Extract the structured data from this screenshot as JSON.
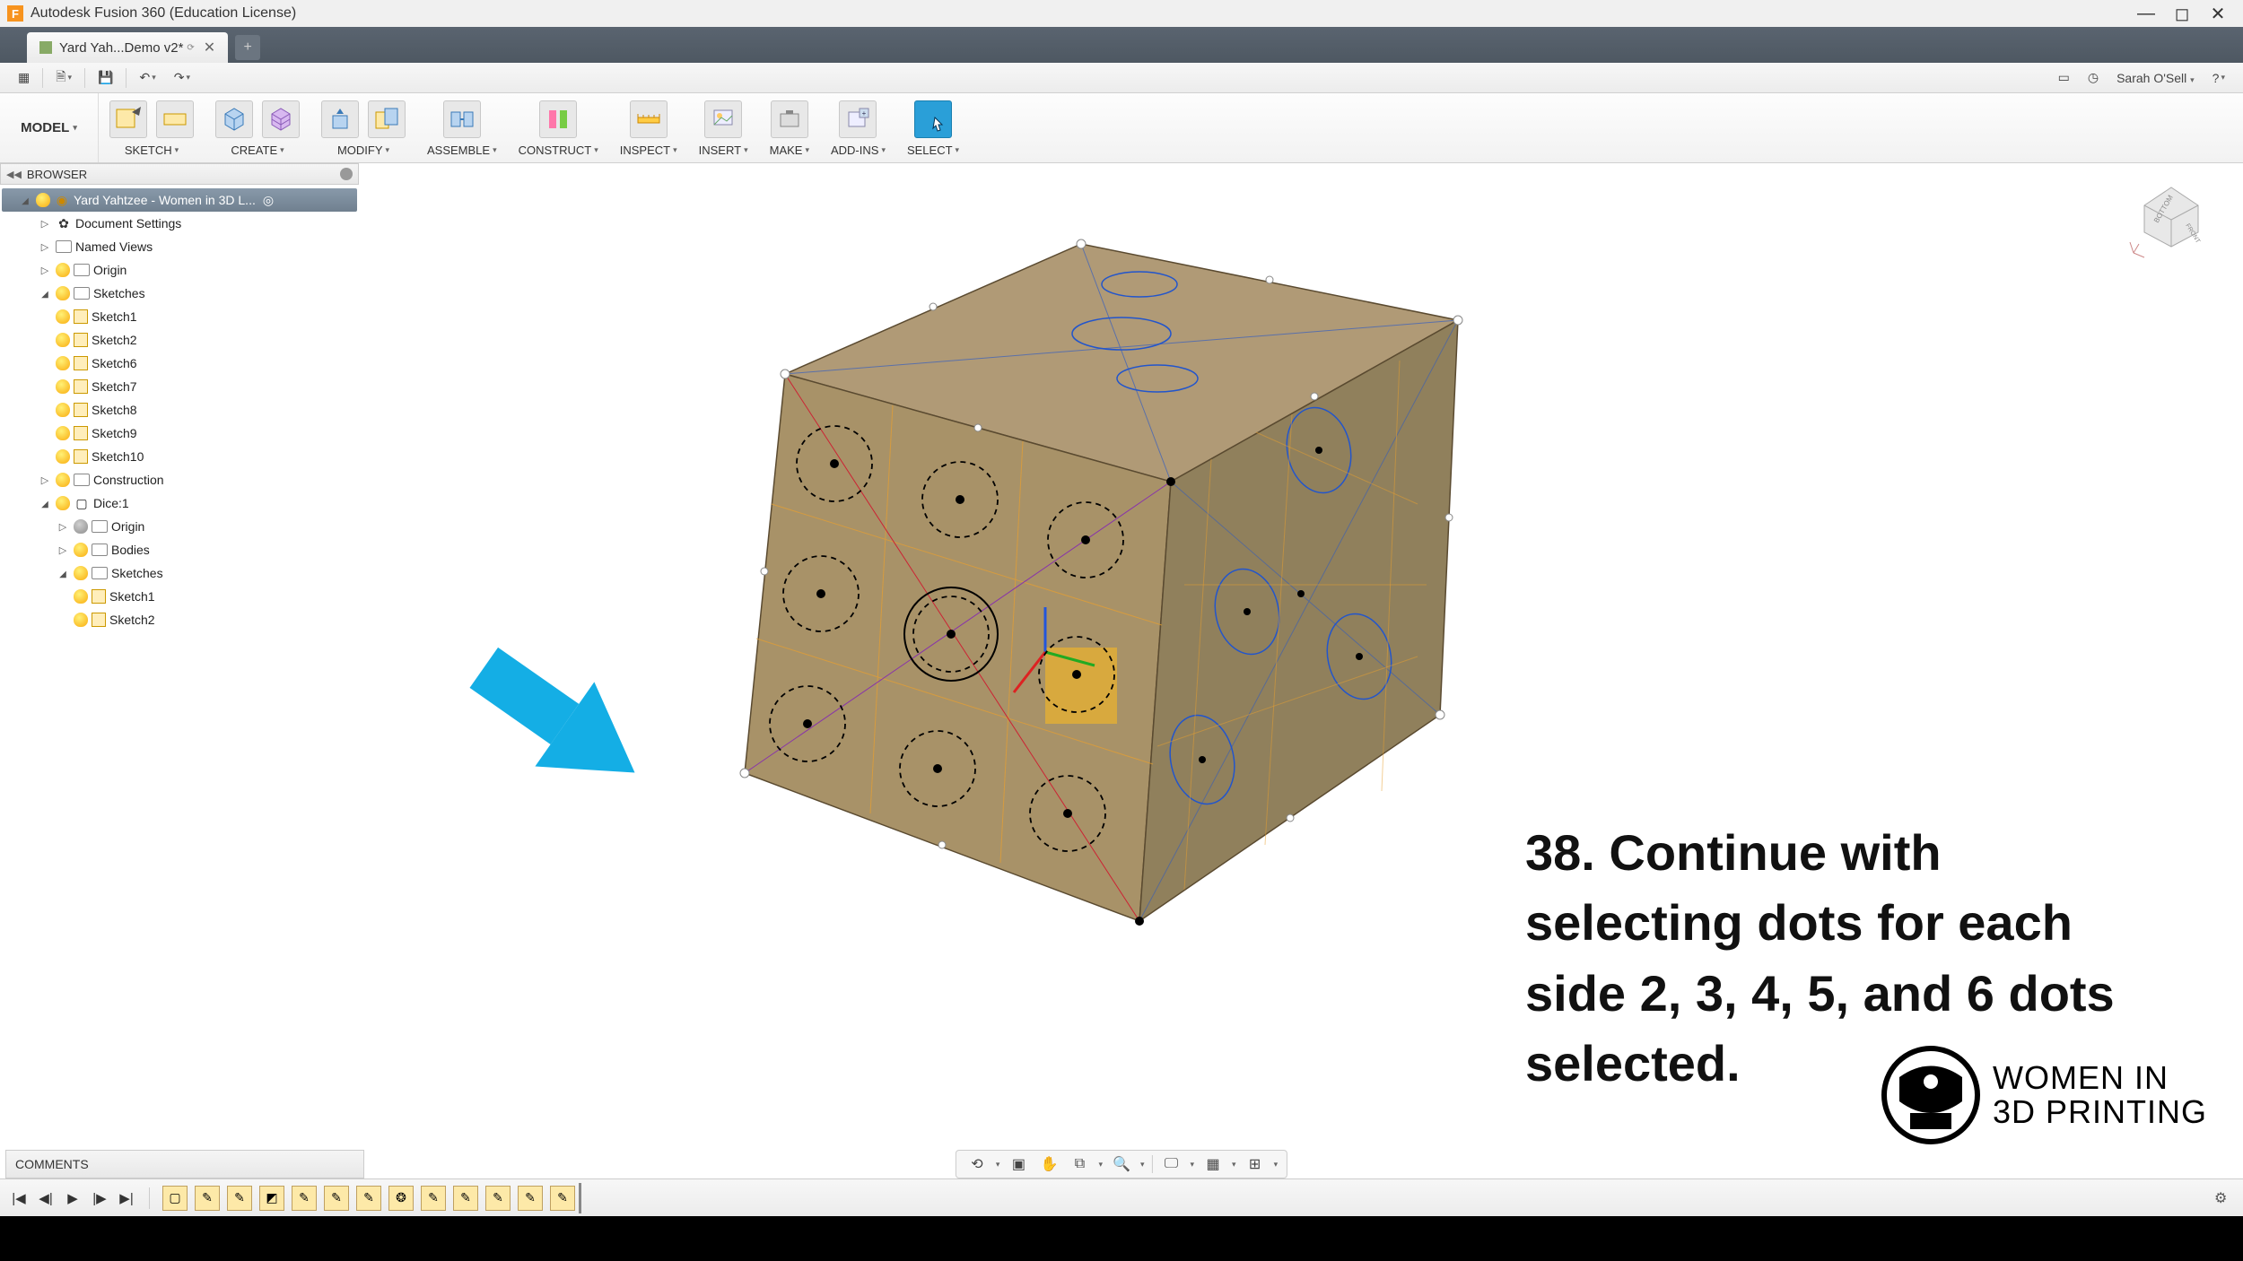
{
  "app": {
    "title": "Autodesk Fusion 360 (Education License)"
  },
  "tab": {
    "label": "Yard Yah...Demo v2*"
  },
  "user": {
    "name": "Sarah O'Sell"
  },
  "ribbon": {
    "workspace": "MODEL",
    "groups": {
      "sketch": "SKETCH",
      "create": "CREATE",
      "modify": "MODIFY",
      "assemble": "ASSEMBLE",
      "construct": "CONSTRUCT",
      "inspect": "INSPECT",
      "insert": "INSERT",
      "make": "MAKE",
      "addins": "ADD-INS",
      "select": "SELECT"
    }
  },
  "browser": {
    "title": "BROWSER",
    "root": "Yard Yahtzee - Women in 3D L...",
    "doc_settings": "Document Settings",
    "named_views": "Named Views",
    "origin": "Origin",
    "sketches": "Sketches",
    "sketch1": "Sketch1",
    "sketch2": "Sketch2",
    "sketch6": "Sketch6",
    "sketch7": "Sketch7",
    "sketch8": "Sketch8",
    "sketch9": "Sketch9",
    "sketch10": "Sketch10",
    "construction": "Construction",
    "dice": "Dice:1",
    "dice_origin": "Origin",
    "bodies": "Bodies",
    "dice_sketches": "Sketches",
    "dice_sketch1": "Sketch1",
    "dice_sketch2": "Sketch2"
  },
  "comments": {
    "title": "COMMENTS"
  },
  "viewcube": {
    "face1": "BOTTOM",
    "face2": "FRONT"
  },
  "instruction": {
    "text": "38. Continue with selecting dots for each side 2, 3, 4, 5, and 6 dots selected."
  },
  "logo": {
    "line1": "WOMEN IN",
    "line2": "3D PRINTING"
  }
}
